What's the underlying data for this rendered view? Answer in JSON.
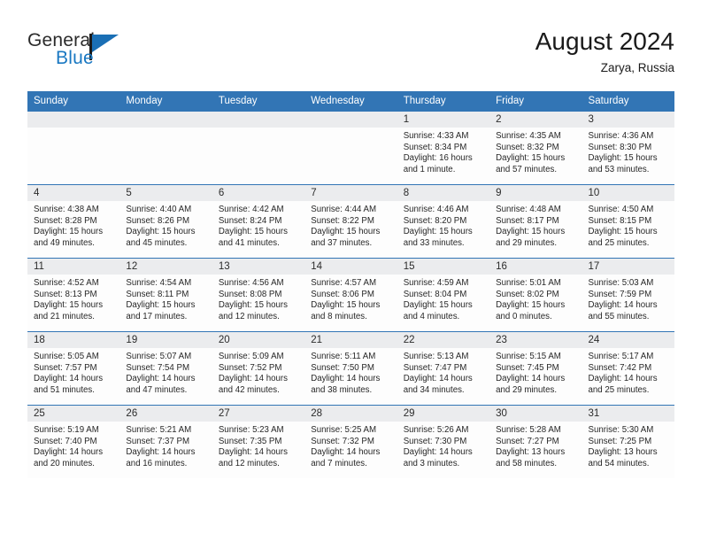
{
  "brand": {
    "name_part1": "General",
    "name_part2": "Blue",
    "flag_icon": "flag-triangle-icon",
    "accent_color": "#1a78c2"
  },
  "header": {
    "title": "August 2024",
    "location": "Zarya, Russia",
    "header_bg_color": "#3275b5",
    "daynum_bg_color": "#ebecee"
  },
  "weekday_headers": [
    "Sunday",
    "Monday",
    "Tuesday",
    "Wednesday",
    "Thursday",
    "Friday",
    "Saturday"
  ],
  "calendar": {
    "month": "August",
    "year": "2024",
    "weeks": [
      [
        {
          "day": "",
          "blank": true
        },
        {
          "day": "",
          "blank": true
        },
        {
          "day": "",
          "blank": true
        },
        {
          "day": "",
          "blank": true
        },
        {
          "day": "1",
          "sunrise": "Sunrise: 4:33 AM",
          "sunset": "Sunset: 8:34 PM",
          "daylight_l1": "Daylight: 16 hours",
          "daylight_l2": "and 1 minute."
        },
        {
          "day": "2",
          "sunrise": "Sunrise: 4:35 AM",
          "sunset": "Sunset: 8:32 PM",
          "daylight_l1": "Daylight: 15 hours",
          "daylight_l2": "and 57 minutes."
        },
        {
          "day": "3",
          "sunrise": "Sunrise: 4:36 AM",
          "sunset": "Sunset: 8:30 PM",
          "daylight_l1": "Daylight: 15 hours",
          "daylight_l2": "and 53 minutes."
        }
      ],
      [
        {
          "day": "4",
          "sunrise": "Sunrise: 4:38 AM",
          "sunset": "Sunset: 8:28 PM",
          "daylight_l1": "Daylight: 15 hours",
          "daylight_l2": "and 49 minutes."
        },
        {
          "day": "5",
          "sunrise": "Sunrise: 4:40 AM",
          "sunset": "Sunset: 8:26 PM",
          "daylight_l1": "Daylight: 15 hours",
          "daylight_l2": "and 45 minutes."
        },
        {
          "day": "6",
          "sunrise": "Sunrise: 4:42 AM",
          "sunset": "Sunset: 8:24 PM",
          "daylight_l1": "Daylight: 15 hours",
          "daylight_l2": "and 41 minutes."
        },
        {
          "day": "7",
          "sunrise": "Sunrise: 4:44 AM",
          "sunset": "Sunset: 8:22 PM",
          "daylight_l1": "Daylight: 15 hours",
          "daylight_l2": "and 37 minutes."
        },
        {
          "day": "8",
          "sunrise": "Sunrise: 4:46 AM",
          "sunset": "Sunset: 8:20 PM",
          "daylight_l1": "Daylight: 15 hours",
          "daylight_l2": "and 33 minutes."
        },
        {
          "day": "9",
          "sunrise": "Sunrise: 4:48 AM",
          "sunset": "Sunset: 8:17 PM",
          "daylight_l1": "Daylight: 15 hours",
          "daylight_l2": "and 29 minutes."
        },
        {
          "day": "10",
          "sunrise": "Sunrise: 4:50 AM",
          "sunset": "Sunset: 8:15 PM",
          "daylight_l1": "Daylight: 15 hours",
          "daylight_l2": "and 25 minutes."
        }
      ],
      [
        {
          "day": "11",
          "sunrise": "Sunrise: 4:52 AM",
          "sunset": "Sunset: 8:13 PM",
          "daylight_l1": "Daylight: 15 hours",
          "daylight_l2": "and 21 minutes."
        },
        {
          "day": "12",
          "sunrise": "Sunrise: 4:54 AM",
          "sunset": "Sunset: 8:11 PM",
          "daylight_l1": "Daylight: 15 hours",
          "daylight_l2": "and 17 minutes."
        },
        {
          "day": "13",
          "sunrise": "Sunrise: 4:56 AM",
          "sunset": "Sunset: 8:08 PM",
          "daylight_l1": "Daylight: 15 hours",
          "daylight_l2": "and 12 minutes."
        },
        {
          "day": "14",
          "sunrise": "Sunrise: 4:57 AM",
          "sunset": "Sunset: 8:06 PM",
          "daylight_l1": "Daylight: 15 hours",
          "daylight_l2": "and 8 minutes."
        },
        {
          "day": "15",
          "sunrise": "Sunrise: 4:59 AM",
          "sunset": "Sunset: 8:04 PM",
          "daylight_l1": "Daylight: 15 hours",
          "daylight_l2": "and 4 minutes."
        },
        {
          "day": "16",
          "sunrise": "Sunrise: 5:01 AM",
          "sunset": "Sunset: 8:02 PM",
          "daylight_l1": "Daylight: 15 hours",
          "daylight_l2": "and 0 minutes."
        },
        {
          "day": "17",
          "sunrise": "Sunrise: 5:03 AM",
          "sunset": "Sunset: 7:59 PM",
          "daylight_l1": "Daylight: 14 hours",
          "daylight_l2": "and 55 minutes."
        }
      ],
      [
        {
          "day": "18",
          "sunrise": "Sunrise: 5:05 AM",
          "sunset": "Sunset: 7:57 PM",
          "daylight_l1": "Daylight: 14 hours",
          "daylight_l2": "and 51 minutes."
        },
        {
          "day": "19",
          "sunrise": "Sunrise: 5:07 AM",
          "sunset": "Sunset: 7:54 PM",
          "daylight_l1": "Daylight: 14 hours",
          "daylight_l2": "and 47 minutes."
        },
        {
          "day": "20",
          "sunrise": "Sunrise: 5:09 AM",
          "sunset": "Sunset: 7:52 PM",
          "daylight_l1": "Daylight: 14 hours",
          "daylight_l2": "and 42 minutes."
        },
        {
          "day": "21",
          "sunrise": "Sunrise: 5:11 AM",
          "sunset": "Sunset: 7:50 PM",
          "daylight_l1": "Daylight: 14 hours",
          "daylight_l2": "and 38 minutes."
        },
        {
          "day": "22",
          "sunrise": "Sunrise: 5:13 AM",
          "sunset": "Sunset: 7:47 PM",
          "daylight_l1": "Daylight: 14 hours",
          "daylight_l2": "and 34 minutes."
        },
        {
          "day": "23",
          "sunrise": "Sunrise: 5:15 AM",
          "sunset": "Sunset: 7:45 PM",
          "daylight_l1": "Daylight: 14 hours",
          "daylight_l2": "and 29 minutes."
        },
        {
          "day": "24",
          "sunrise": "Sunrise: 5:17 AM",
          "sunset": "Sunset: 7:42 PM",
          "daylight_l1": "Daylight: 14 hours",
          "daylight_l2": "and 25 minutes."
        }
      ],
      [
        {
          "day": "25",
          "sunrise": "Sunrise: 5:19 AM",
          "sunset": "Sunset: 7:40 PM",
          "daylight_l1": "Daylight: 14 hours",
          "daylight_l2": "and 20 minutes."
        },
        {
          "day": "26",
          "sunrise": "Sunrise: 5:21 AM",
          "sunset": "Sunset: 7:37 PM",
          "daylight_l1": "Daylight: 14 hours",
          "daylight_l2": "and 16 minutes."
        },
        {
          "day": "27",
          "sunrise": "Sunrise: 5:23 AM",
          "sunset": "Sunset: 7:35 PM",
          "daylight_l1": "Daylight: 14 hours",
          "daylight_l2": "and 12 minutes."
        },
        {
          "day": "28",
          "sunrise": "Sunrise: 5:25 AM",
          "sunset": "Sunset: 7:32 PM",
          "daylight_l1": "Daylight: 14 hours",
          "daylight_l2": "and 7 minutes."
        },
        {
          "day": "29",
          "sunrise": "Sunrise: 5:26 AM",
          "sunset": "Sunset: 7:30 PM",
          "daylight_l1": "Daylight: 14 hours",
          "daylight_l2": "and 3 minutes."
        },
        {
          "day": "30",
          "sunrise": "Sunrise: 5:28 AM",
          "sunset": "Sunset: 7:27 PM",
          "daylight_l1": "Daylight: 13 hours",
          "daylight_l2": "and 58 minutes."
        },
        {
          "day": "31",
          "sunrise": "Sunrise: 5:30 AM",
          "sunset": "Sunset: 7:25 PM",
          "daylight_l1": "Daylight: 13 hours",
          "daylight_l2": "and 54 minutes."
        }
      ]
    ]
  }
}
